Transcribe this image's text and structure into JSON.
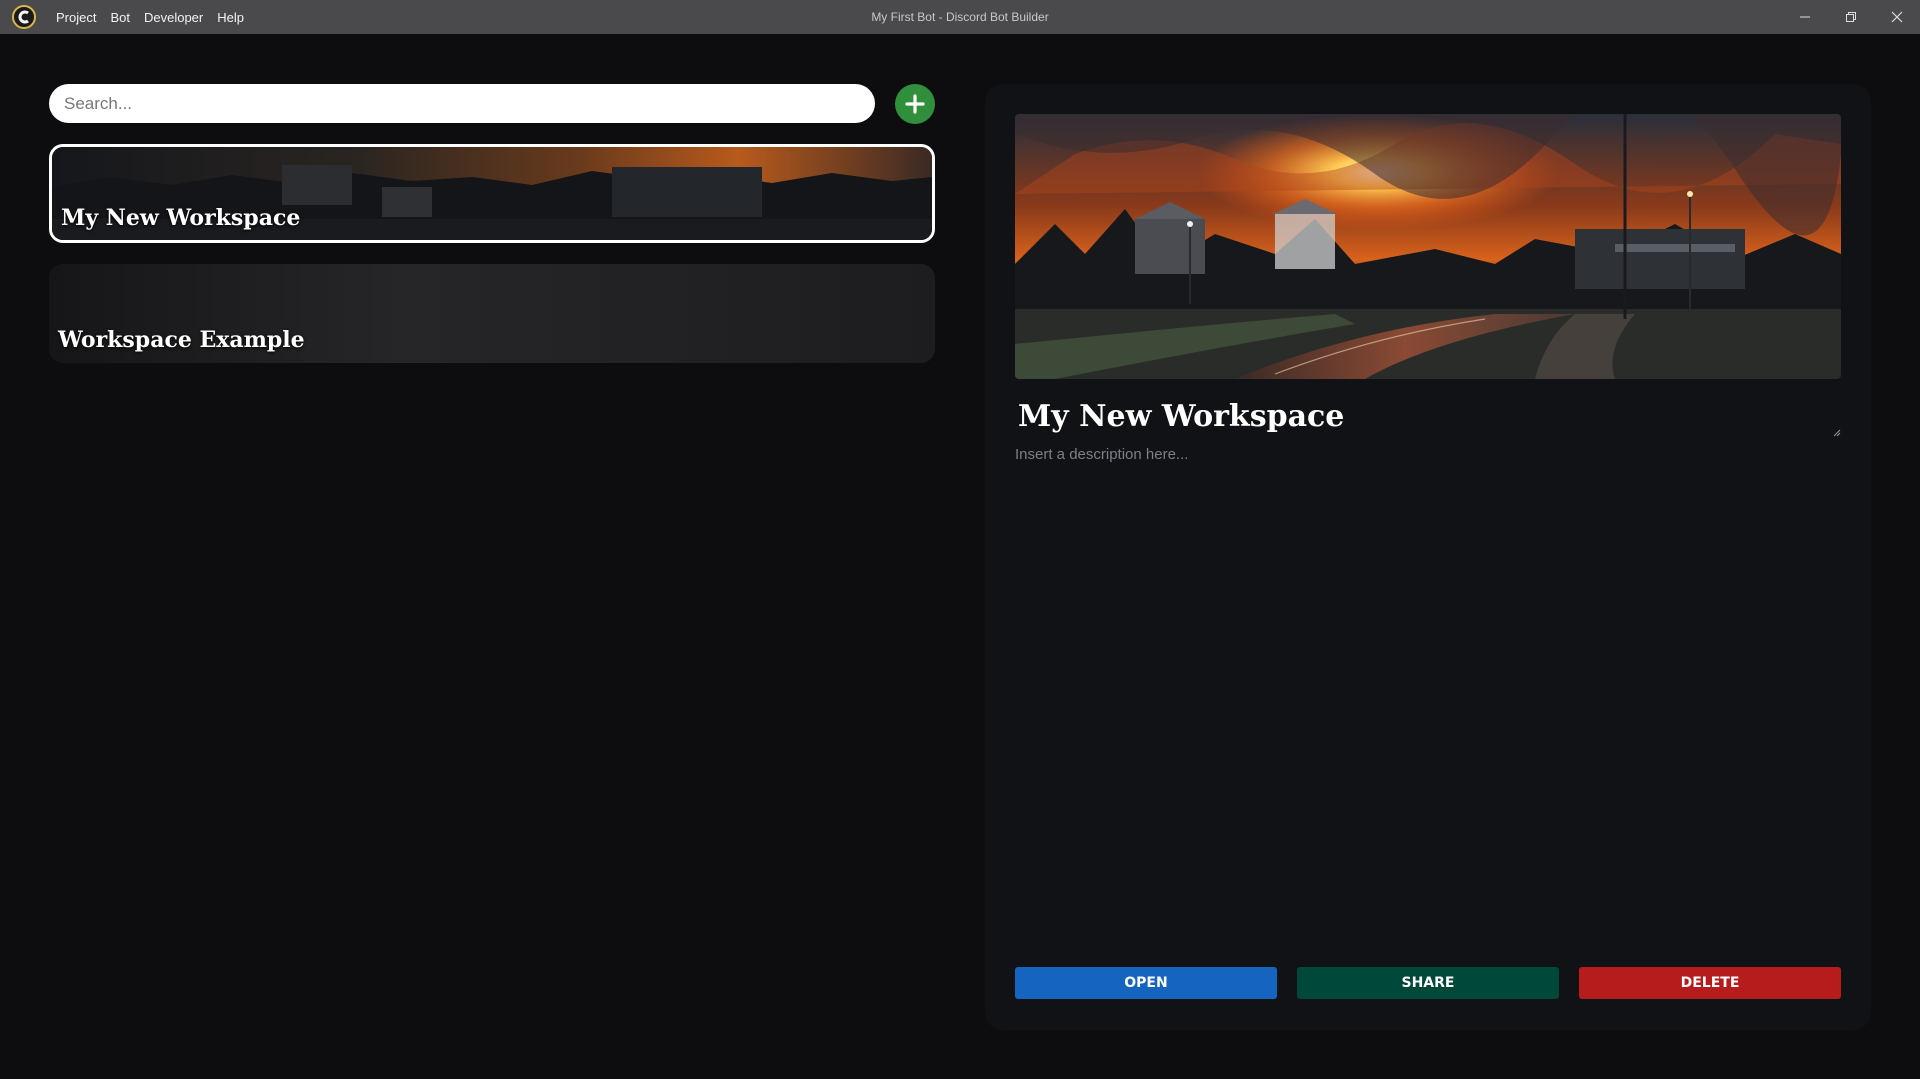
{
  "window": {
    "title": "My First Bot - Discord Bot Builder",
    "menu": [
      {
        "label": "Project"
      },
      {
        "label": "Bot"
      },
      {
        "label": "Developer"
      },
      {
        "label": "Help"
      }
    ],
    "icons": [
      "app-logo-icon",
      "minimize-icon",
      "restore-icon",
      "close-icon"
    ]
  },
  "sidebar": {
    "search": {
      "placeholder": "Search...",
      "value": ""
    },
    "add_icon": "plus-icon",
    "workspaces": [
      {
        "name": "My New Workspace",
        "selected": true
      },
      {
        "name": "Workspace Example",
        "selected": false
      }
    ]
  },
  "detail": {
    "title": "My New Workspace",
    "description_placeholder": "Insert a description here...",
    "description_value": "",
    "buttons": {
      "open": "OPEN",
      "share": "SHARE",
      "delete": "DELETE"
    }
  },
  "colors": {
    "titlebar": "#4a4a4c",
    "background": "#0d0d0f",
    "panel": "#111216",
    "add": "#2f8f3a",
    "open": "#1565c0",
    "share": "#00483a",
    "delete": "#b71c1c"
  }
}
